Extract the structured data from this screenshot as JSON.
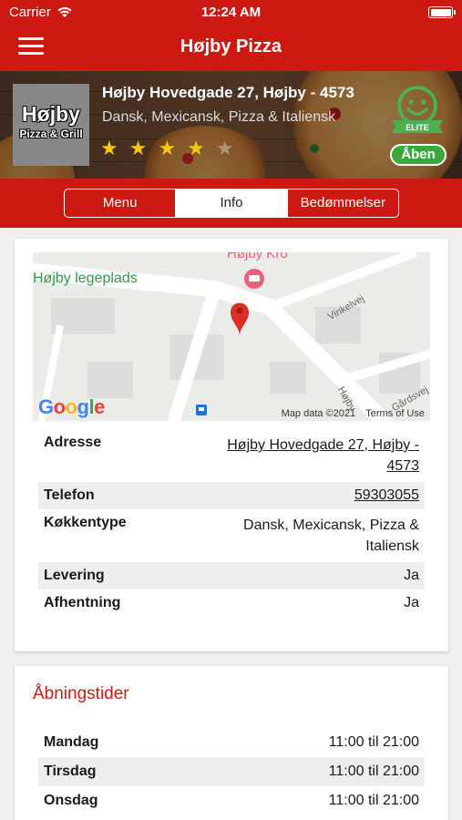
{
  "status_bar": {
    "carrier": "Carrier",
    "time": "12:24 AM"
  },
  "nav": {
    "title": "Højby Pizza",
    "menu_icon": "hamburger-menu-icon"
  },
  "restaurant": {
    "logo_line1": "Højby",
    "logo_line2": "Pizza & Grill",
    "address": "Højby Hovedgade 27, Højby - 4573",
    "cuisine": "Dansk, Mexicansk, Pizza & Italiensk",
    "rating": 3.5,
    "rating_max": 5,
    "elite_label": "ELITE",
    "open_status": "Åben"
  },
  "tabs": [
    {
      "label": "Menu",
      "active": false
    },
    {
      "label": "Info",
      "active": true
    },
    {
      "label": "Bedømmelser",
      "active": false
    }
  ],
  "map": {
    "place_label": "Højby legeplads",
    "kro_label": "Højby Kro",
    "road1": "Vinkelvej",
    "road2": "Højby",
    "road3": "Gårdsvej",
    "google": "Google",
    "map_data": "Map data ©2021",
    "terms": "Terms of Use"
  },
  "info": {
    "address_label": "Adresse",
    "address_value": "Højby Hovedgade 27, Højby - 4573",
    "phone_label": "Telefon",
    "phone_value": "59303055",
    "cuisine_label": "Køkkentype",
    "cuisine_value": "Dansk, Mexicansk, Pizza & Italiensk",
    "delivery_label": "Levering",
    "delivery_value": "Ja",
    "pickup_label": "Afhentning",
    "pickup_value": "Ja"
  },
  "hours": {
    "title": "Åbningstider",
    "days": [
      {
        "day": "Mandag",
        "time": "11:00 til 21:00"
      },
      {
        "day": "Tirsdag",
        "time": "11:00 til 21:00"
      },
      {
        "day": "Onsdag",
        "time": "11:00 til 21:00"
      }
    ]
  },
  "colors": {
    "brand_red": "#cc1a12",
    "open_green": "#3aa83a",
    "elite_green": "#4caf50",
    "star_yellow": "#f5c518"
  }
}
